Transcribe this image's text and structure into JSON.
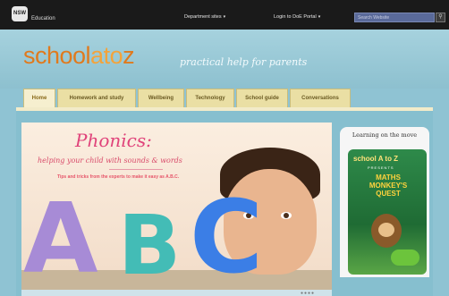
{
  "topbar": {
    "logo_text": "NSW",
    "org_label": "Education",
    "links": [
      {
        "label": "Department sites"
      },
      {
        "label": "Login to DoE Portal"
      }
    ],
    "search_placeholder": "Search Website",
    "search_button_icon": "search-icon"
  },
  "header": {
    "brand_parts": [
      "school",
      "ato",
      "z"
    ],
    "tagline": "practical help for parents",
    "colors": {
      "brand_orange": "#e07a1d",
      "brand_light_orange": "#f3a33b"
    }
  },
  "nav": {
    "tabs": [
      {
        "label": "Home",
        "active": true
      },
      {
        "label": "Homework and study",
        "active": false
      },
      {
        "label": "Wellbeing",
        "active": false
      },
      {
        "label": "Technology",
        "active": false
      },
      {
        "label": "School guide",
        "active": false
      },
      {
        "label": "Conversations",
        "active": false
      }
    ]
  },
  "hero": {
    "title": "Phonics:",
    "subtitle": "helping your child with sounds & words",
    "tips": "Tips and tricks from the experts to make it easy as A.B.C.",
    "letters": [
      "A",
      "B",
      "C"
    ],
    "colors": {
      "title": "#e0437a",
      "letter_a": "#a78bd6",
      "letter_b": "#43bcb6",
      "letter_c": "#3b7ee6"
    }
  },
  "sidebar": {
    "heading": "Learning on the move",
    "game": {
      "logo": "school A to Z",
      "presents": "PRESENTS",
      "title": "MATHS MONKEY'S QUEST"
    }
  }
}
